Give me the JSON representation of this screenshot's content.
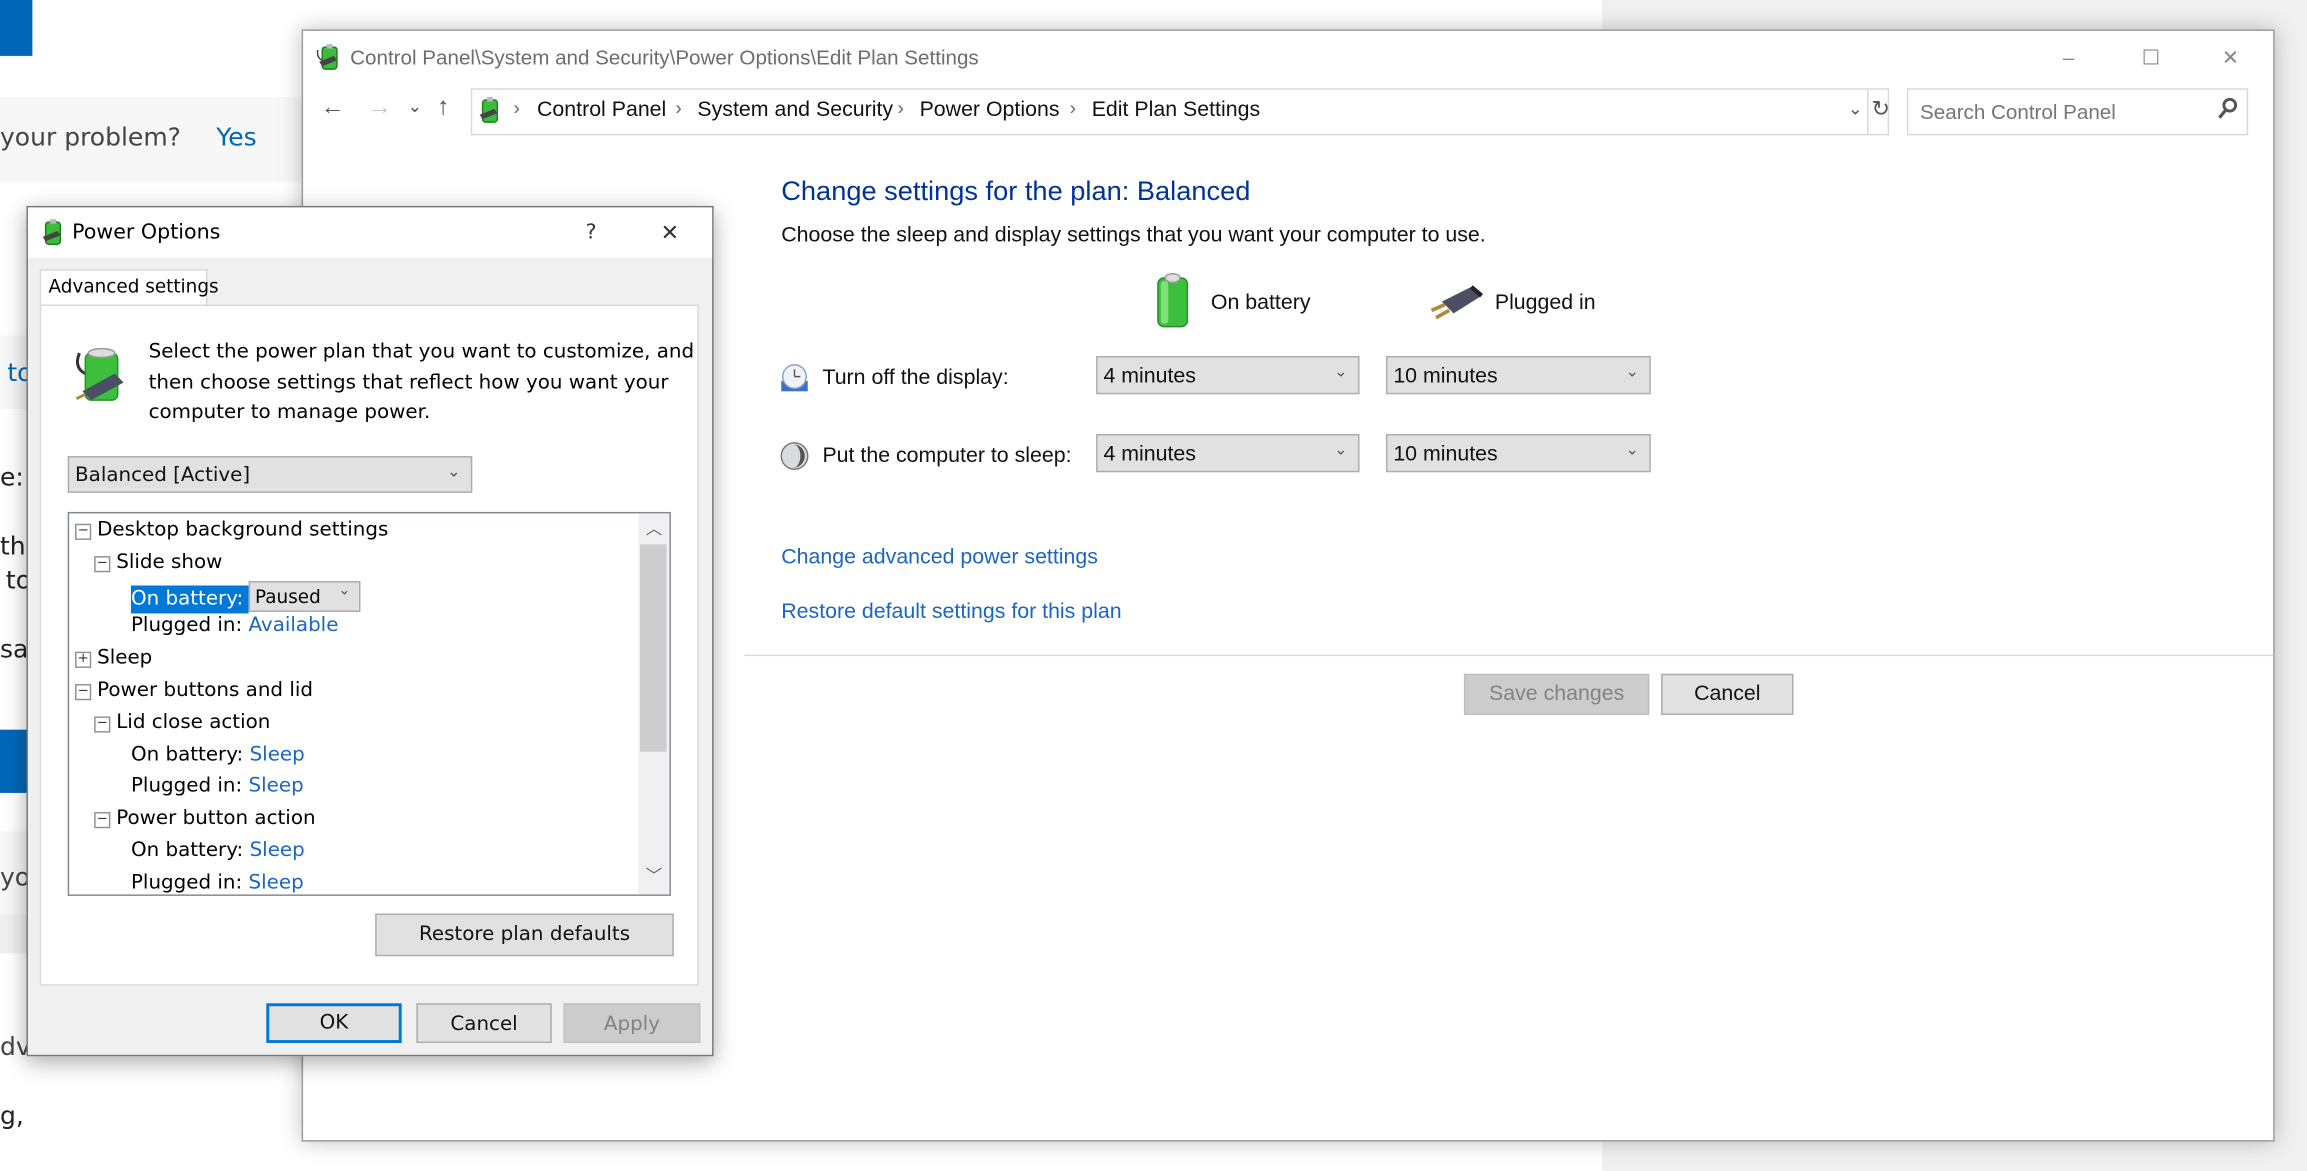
{
  "background_page": {
    "fragments": [
      "your problem?",
      "Yes",
      "to",
      "e:",
      "the",
      "to",
      "sal",
      "yo",
      "dv",
      "g,"
    ]
  },
  "main_window": {
    "title": "Control Panel\\System and Security\\Power Options\\Edit Plan Settings",
    "caption_buttons": {
      "minimize": "–",
      "maximize": "☐",
      "close": "✕"
    },
    "nav": {
      "back": "←",
      "forward": "→",
      "recent": "⌄",
      "up": "↑"
    },
    "breadcrumb": [
      "Control Panel",
      "System and Security",
      "Power Options",
      "Edit Plan Settings"
    ],
    "breadcrumb_separator": "›",
    "refresh_glyph": "↻",
    "search": {
      "placeholder": "Search Control Panel",
      "icon": "search-icon"
    },
    "heading": "Change settings for the plan: Balanced",
    "subheading": "Choose the sleep and display settings that you want your computer to use.",
    "columns": {
      "battery": "On battery",
      "plugged": "Plugged in"
    },
    "settings": [
      {
        "label": "Turn off the display:",
        "icon": "display-clock-icon",
        "on_battery": "4 minutes",
        "plugged_in": "10 minutes"
      },
      {
        "label": "Put the computer to sleep:",
        "icon": "moon-sleep-icon",
        "on_battery": "4 minutes",
        "plugged_in": "10 minutes"
      }
    ],
    "links": {
      "advanced": "Change advanced power settings",
      "restore": "Restore default settings for this plan"
    },
    "buttons": {
      "save": "Save changes",
      "cancel": "Cancel"
    }
  },
  "dialog": {
    "title": "Power Options",
    "help": "?",
    "close": "✕",
    "tab": "Advanced settings",
    "intro": [
      "Select the power plan that you want to customize, and",
      "then choose settings that reflect how you want your",
      "computer to manage power."
    ],
    "plan_select": "Balanced [Active]",
    "tree": [
      {
        "level": 0,
        "expander": "−",
        "label": "Desktop background settings"
      },
      {
        "level": 1,
        "expander": "−",
        "label": "Slide show"
      },
      {
        "level": 2,
        "label": "On battery:",
        "value": "Paused",
        "selected": true,
        "editing": true
      },
      {
        "level": 2,
        "label": "Plugged in:",
        "value": "Available"
      },
      {
        "level": 0,
        "expander": "+",
        "label": "Sleep"
      },
      {
        "level": 0,
        "expander": "−",
        "label": "Power buttons and lid"
      },
      {
        "level": 1,
        "expander": "−",
        "label": "Lid close action"
      },
      {
        "level": 2,
        "label": "On battery:",
        "value": "Sleep"
      },
      {
        "level": 2,
        "label": "Plugged in:",
        "value": "Sleep"
      },
      {
        "level": 1,
        "expander": "−",
        "label": "Power button action"
      },
      {
        "level": 2,
        "label": "On battery:",
        "value": "Sleep"
      },
      {
        "level": 2,
        "label": "Plugged in:",
        "value": "Sleep"
      }
    ],
    "restore_button": "Restore plan defaults",
    "buttons": {
      "ok": "OK",
      "cancel": "Cancel",
      "apply": "Apply"
    }
  },
  "colors": {
    "accent": "#0078d7",
    "link": "#1a66c2",
    "heading": "#003399",
    "selection": "#0078d7"
  }
}
